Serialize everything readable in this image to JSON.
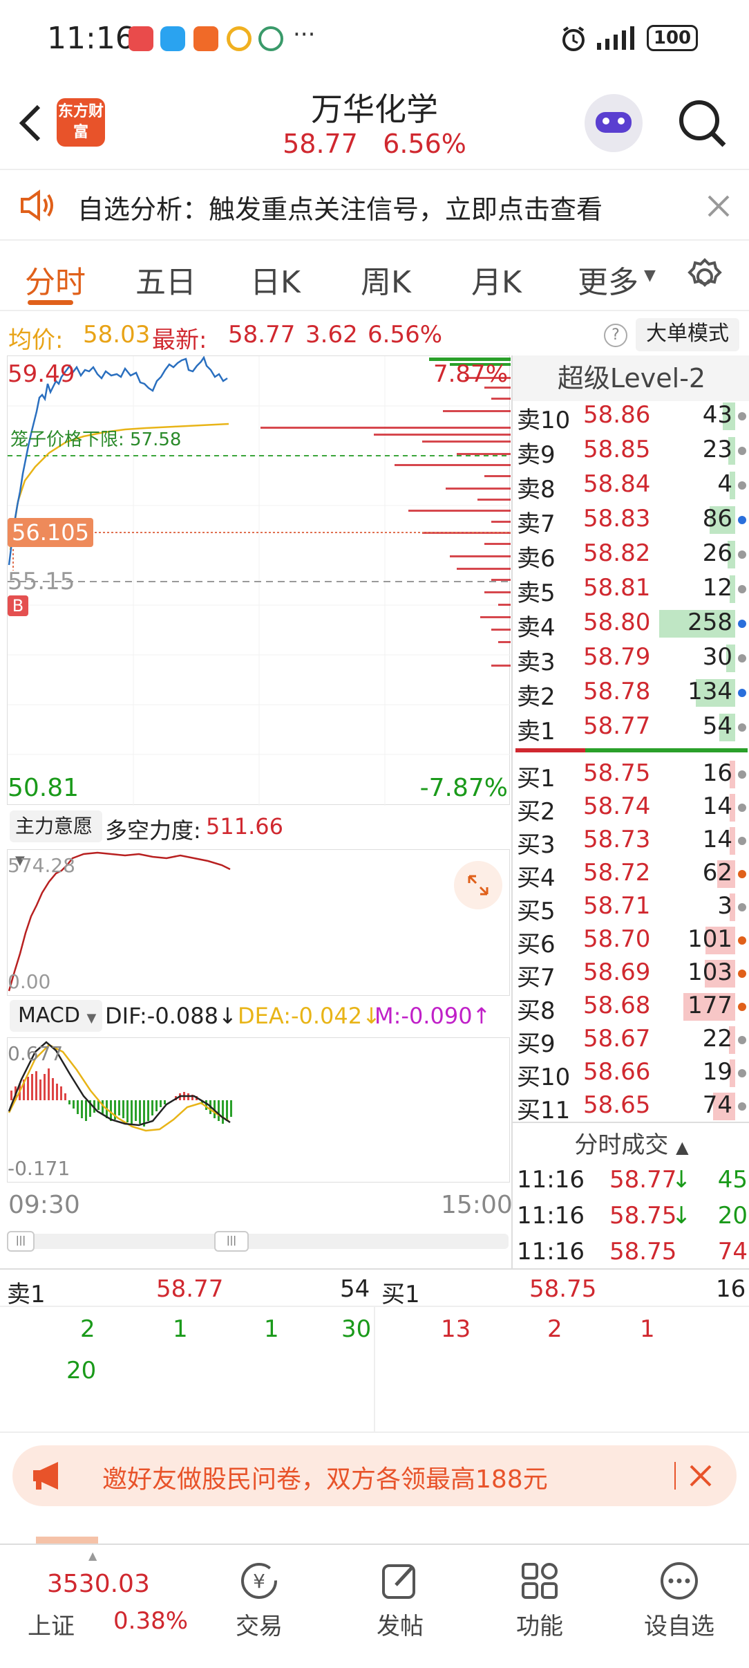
{
  "status": {
    "time": "11:16",
    "battery": "100",
    "more": "···"
  },
  "header": {
    "logo": "东方财富",
    "title": "万华化学",
    "price": "58.77",
    "pct": "6.56%"
  },
  "notice": {
    "text": "自选分析：触发重点关注信号，立即点击查看"
  },
  "tabs": [
    "分时",
    "五日",
    "日K",
    "周K",
    "月K",
    "更多"
  ],
  "info": {
    "avg_label": "均价:",
    "avg": "58.03",
    "last_label": "最新:",
    "last": "58.77",
    "chg": "3.62",
    "pct": "6.56%",
    "big_mode": "大单模式"
  },
  "chart": {
    "hi_price": "59.49",
    "hi_pct": "7.87%",
    "lo_price": "50.81",
    "lo_pct": "-7.87%",
    "cage_label": "笼子价格下限:",
    "cage_value": "57.58",
    "cursor_price": "56.105",
    "prev_close": "55.15",
    "b_marker": "B",
    "ind1_select": "主力意愿",
    "ind1_label": "多空力度:",
    "ind1_value": "511.66",
    "ind1_top": "574.28",
    "ind1_bottom": "0.00",
    "macd_select": "MACD",
    "dif": "DIF:-0.088",
    "dea": "DEA:-0.042",
    "m": "M:-0.090",
    "macd_top": "0.677",
    "macd_bottom": "-0.171",
    "t_start": "09:30",
    "t_end": "15:00"
  },
  "book": {
    "title": "超级Level-2",
    "asks": [
      {
        "l": "卖10",
        "p": "58.86",
        "v": "43",
        "c": "#9a9a9a"
      },
      {
        "l": "卖9",
        "p": "58.85",
        "v": "23",
        "c": "#9a9a9a"
      },
      {
        "l": "卖8",
        "p": "58.84",
        "v": "4",
        "c": "#9a9a9a"
      },
      {
        "l": "卖7",
        "p": "58.83",
        "v": "86",
        "c": "#2a6fdb"
      },
      {
        "l": "卖6",
        "p": "58.82",
        "v": "26",
        "c": "#9a9a9a"
      },
      {
        "l": "卖5",
        "p": "58.81",
        "v": "12",
        "c": "#9a9a9a"
      },
      {
        "l": "卖4",
        "p": "58.80",
        "v": "258",
        "c": "#2a6fdb"
      },
      {
        "l": "卖3",
        "p": "58.79",
        "v": "30",
        "c": "#9a9a9a"
      },
      {
        "l": "卖2",
        "p": "58.78",
        "v": "134",
        "c": "#2a6fdb"
      },
      {
        "l": "卖1",
        "p": "58.77",
        "v": "54",
        "c": "#9a9a9a"
      }
    ],
    "bids": [
      {
        "l": "买1",
        "p": "58.75",
        "v": "16",
        "c": "#9a9a9a"
      },
      {
        "l": "买2",
        "p": "58.74",
        "v": "14",
        "c": "#9a9a9a"
      },
      {
        "l": "买3",
        "p": "58.73",
        "v": "14",
        "c": "#9a9a9a"
      },
      {
        "l": "买4",
        "p": "58.72",
        "v": "62",
        "c": "#e0601a"
      },
      {
        "l": "买5",
        "p": "58.71",
        "v": "3",
        "c": "#9a9a9a"
      },
      {
        "l": "买6",
        "p": "58.70",
        "v": "101",
        "c": "#e0601a"
      },
      {
        "l": "买7",
        "p": "58.69",
        "v": "103",
        "c": "#e0601a"
      },
      {
        "l": "买8",
        "p": "58.68",
        "v": "177",
        "c": "#e0601a"
      },
      {
        "l": "买9",
        "p": "58.67",
        "v": "22",
        "c": "#9a9a9a"
      },
      {
        "l": "买10",
        "p": "58.66",
        "v": "19",
        "c": "#9a9a9a"
      },
      {
        "l": "买11",
        "p": "58.65",
        "v": "74",
        "c": "#9a9a9a"
      }
    ],
    "trades_title": "分时成交",
    "trades": [
      {
        "t": "11:16",
        "p": "58.77",
        "a": "↓",
        "v": "45"
      },
      {
        "t": "11:16",
        "p": "58.75",
        "a": "↓",
        "v": "20"
      },
      {
        "t": "11:16",
        "p": "58.75",
        "a": "",
        "v": "74"
      }
    ]
  },
  "queue": {
    "ask_label": "卖1",
    "ask_price": "58.77",
    "ask_vol": "54",
    "ask_orders": [
      "2",
      "1",
      "1",
      "30",
      "20"
    ],
    "bid_label": "买1",
    "bid_price": "58.75",
    "bid_vol": "16",
    "bid_orders": [
      "13",
      "2",
      "1"
    ]
  },
  "banner": {
    "text": "邀好友做股民问卷，双方各领最高188元"
  },
  "bottom": {
    "index_value": "3530.03",
    "index_name": "上证",
    "index_pct": "0.38%",
    "items": [
      "交易",
      "发帖",
      "功能",
      "设自选"
    ]
  }
}
